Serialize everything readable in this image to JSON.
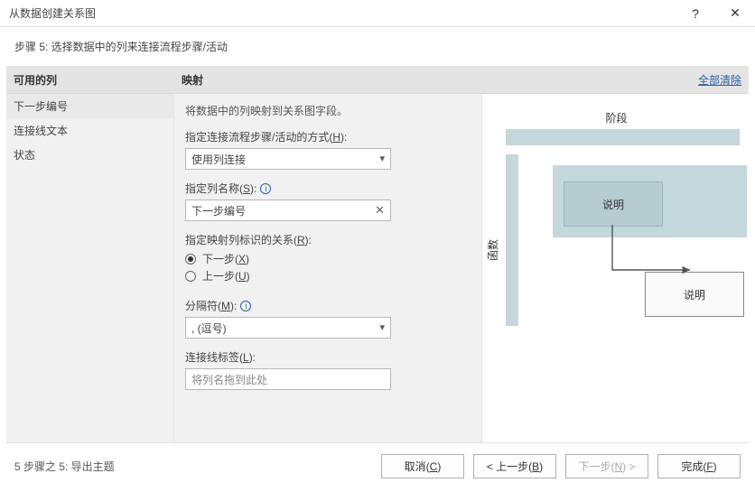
{
  "titlebar": {
    "title": "从数据创建关系图",
    "help": "?",
    "close": "✕"
  },
  "subtitle": "步骤 5: 选择数据中的列来连接流程步骤/活动",
  "sidebar": {
    "header": "可用的列",
    "items": [
      "下一步编号",
      "连接线文本",
      "状态"
    ]
  },
  "content": {
    "header": "映射",
    "clear_all": "全部清除",
    "desc": "将数据中的列映射到关系图字段。",
    "method_label_pre": "指定连接流程步骤/活动的方式(",
    "method_key": "H",
    "method_label_post": "):",
    "method_value": "使用列连接",
    "colname_label_pre": "指定列名称(",
    "colname_key": "S",
    "colname_label_post": "):",
    "colname_value": "下一步编号",
    "relation_label_pre": "指定映射列标识的关系(",
    "relation_key": "R",
    "relation_label_post": "):",
    "radio_next_pre": "下一步(",
    "radio_next_key": "X",
    "radio_next_post": ")",
    "radio_prev_pre": "上一步(",
    "radio_prev_key": "U",
    "radio_prev_post": ")",
    "separator_label_pre": "分隔符(",
    "separator_key": "M",
    "separator_label_post": "):",
    "separator_value": ", (逗号)",
    "connector_label_pre": "连接线标签(",
    "connector_key": "L",
    "connector_label_post": "):",
    "connector_placeholder": "将列名拖到此处"
  },
  "preview": {
    "top_label": "阶段",
    "side_label": "函数",
    "box1": "说明",
    "box2": "说明"
  },
  "footer": {
    "status": "5 步骤之 5: 导出主题",
    "cancel_pre": "取消(",
    "cancel_key": "C",
    "cancel_post": ")",
    "back_pre": "< 上一步(",
    "back_key": "B",
    "back_post": ")",
    "next_pre": "下一步(",
    "next_key": "N",
    "next_post": ") >",
    "finish_pre": "完成(",
    "finish_key": "F",
    "finish_post": ")"
  }
}
